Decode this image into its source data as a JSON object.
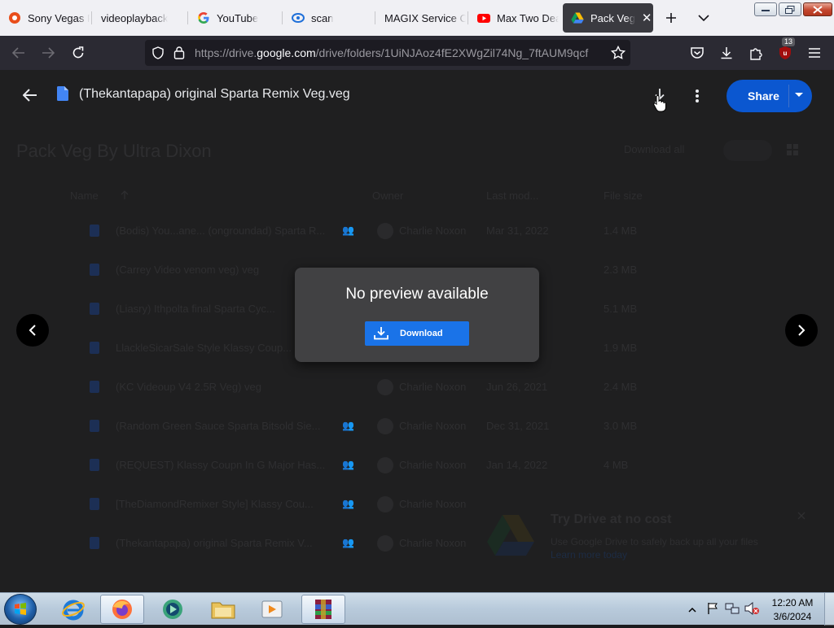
{
  "browser": {
    "tabs": [
      {
        "title": "Sony Vegas Pr",
        "icon": "sony-vegas-favicon",
        "active": false
      },
      {
        "title": "videoplayback",
        "icon": "none",
        "active": false
      },
      {
        "title": "YouTube",
        "icon": "google-favicon",
        "active": false
      },
      {
        "title": "scan",
        "icon": "scan-favicon",
        "active": false
      },
      {
        "title": "MAGIX Service Ce",
        "icon": "none",
        "active": false
      },
      {
        "title": "Max Two Dea",
        "icon": "youtube-favicon",
        "active": false
      },
      {
        "title": "Pack Veg B",
        "icon": "google-drive-favicon",
        "active": true
      }
    ],
    "url_prefix": "https://drive.",
    "url_host": "google.com",
    "url_path": "/drive/folders/1UiNJAoz4fE2XWgZil74Ng_7ftAUM9qcf",
    "extension_badge": "13"
  },
  "viewer": {
    "file_title": "(Thekantapapa) original Sparta Remix Veg.veg",
    "share_label": "Share",
    "no_preview_message": "No preview available",
    "download_label": "Download"
  },
  "drive": {
    "folder_title": "Pack Veg By Ultra Dixon",
    "download_all_label": "Download all",
    "columns": {
      "name": "Name",
      "owner": "Owner",
      "last_modified": "Last mod...",
      "file_size": "File size"
    },
    "rows": [
      {
        "name": "(Bodis) You...ane... (ongroundad) Sparta R...",
        "owner": "Charlie Noxon",
        "date": "Mar 31, 2022",
        "size": "1.4 MB"
      },
      {
        "name": "(Carrey Video venom veg) veg",
        "owner": "",
        "date": "",
        "size": "2.3 MB"
      },
      {
        "name": "(Liasry) Ithpolta final Sparta Cyc...",
        "owner": "",
        "date": "",
        "size": "5.1 MB"
      },
      {
        "name": "LlackleSicarSale Style Klassy Coup...",
        "owner": "",
        "date": "",
        "size": "1.9 MB"
      },
      {
        "name": "(KC Videoup V4 2.5R Veg) veg",
        "owner": "Charlie Noxon",
        "date": "Jun 26, 2021",
        "size": "2.4 MB"
      },
      {
        "name": "(Random Green Sauce Sparta Bitsold Sie...",
        "owner": "Charlie Noxon",
        "date": "Dec 31, 2021",
        "size": "3.0 MB"
      },
      {
        "name": "(REQUEST) Klassy Coupn In G Major Has...",
        "owner": "Charlie Noxon",
        "date": "Jan 14, 2022",
        "size": "4 MB"
      },
      {
        "name": "[TheDiamondRemixer Style] Klassy Cou...",
        "owner": "Charlie Noxon",
        "date": "",
        "size": ""
      },
      {
        "name": "(Thekantapapa) original Sparta Remix V...",
        "owner": "Charlie Noxon",
        "date": "",
        "size": ""
      }
    ],
    "promo_title": "Try Drive at no cost",
    "promo_body": "Use Google Drive to safely back up all your files",
    "promo_link": "Learn more today"
  },
  "taskbar": {
    "apps": [
      "internet-explorer",
      "firefox",
      "media-player",
      "file-explorer",
      "video-editor",
      "winrar"
    ],
    "time": "12:20 AM",
    "date": "3/6/2024"
  },
  "colors": {
    "share_blue": "#0b57d0",
    "download_blue": "#1a73e8",
    "dialog_bg": "#414143",
    "tab_active": "#3a3a40"
  }
}
